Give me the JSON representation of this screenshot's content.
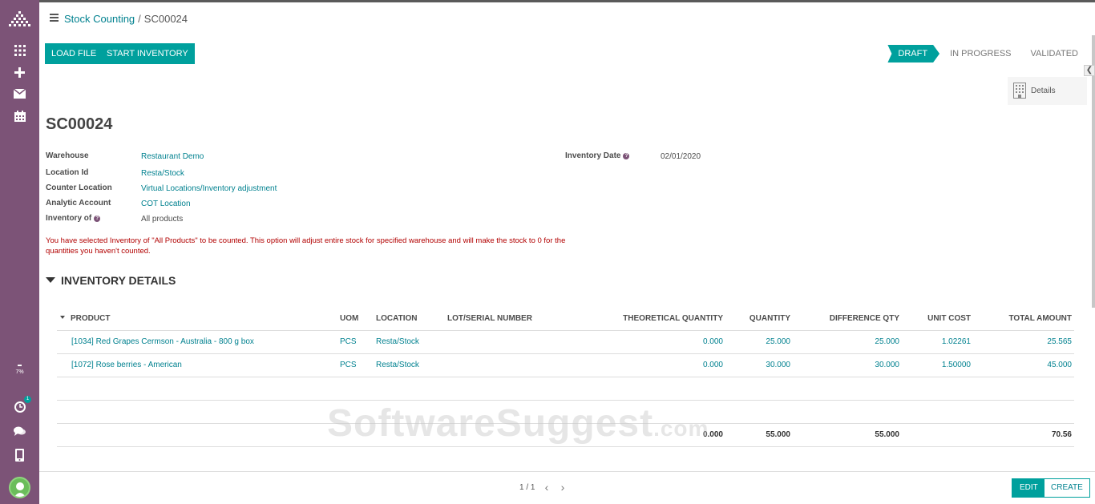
{
  "sidebar": {
    "icons": [
      "apps-icon",
      "plus-icon",
      "mail-icon",
      "calendar-icon"
    ],
    "progress_pct": "7%",
    "activity_count": "1"
  },
  "breadcrumb": {
    "parent": "Stock Counting",
    "current": "SC00024"
  },
  "buttons": {
    "load_file": "LOAD FILE",
    "start_inventory": "START INVENTORY"
  },
  "stages": [
    {
      "label": "DRAFT",
      "active": true
    },
    {
      "label": "IN PROGRESS",
      "active": false
    },
    {
      "label": "VALIDATED",
      "active": false
    }
  ],
  "details_label": "Details",
  "record": {
    "title": "SC00024",
    "fields": {
      "warehouse": {
        "label": "Warehouse",
        "value": "Restaurant Demo"
      },
      "location": {
        "label": "Location Id",
        "value": "Resta/Stock"
      },
      "counter_location": {
        "label": "Counter Location",
        "value": "Virtual Locations/Inventory adjustment"
      },
      "analytic_account": {
        "label": "Analytic Account",
        "value": "COT Location"
      },
      "inventory_of": {
        "label": "Inventory of",
        "value": "All products"
      },
      "inventory_date": {
        "label": "Inventory Date",
        "value": "02/01/2020"
      }
    },
    "warning": "You have selected Inventory of \"All Products\" to be counted. This option will adjust entire stock for specified warehouse and will make the stock to 0 for the quantities you haven't counted."
  },
  "section": {
    "title": "INVENTORY DETAILS"
  },
  "table": {
    "headers": {
      "product": "PRODUCT",
      "uom": "UOM",
      "location": "LOCATION",
      "lot": "LOT/SERIAL NUMBER",
      "theoretical": "THEORETICAL QUANTITY",
      "quantity": "QUANTITY",
      "difference": "DIFFERENCE QTY",
      "unit_cost": "UNIT COST",
      "total": "TOTAL AMOUNT"
    },
    "rows": [
      {
        "product": "[1034] Red Grapes Cermson - Australia - 800 g box",
        "uom": "PCS",
        "location": "Resta/Stock",
        "lot": "",
        "theoretical": "0.000",
        "quantity": "25.000",
        "difference": "25.000",
        "unit_cost": "1.02261",
        "total": "25.565"
      },
      {
        "product": "[1072] Rose berries - American",
        "uom": "PCS",
        "location": "Resta/Stock",
        "lot": "",
        "theoretical": "0.000",
        "quantity": "30.000",
        "difference": "30.000",
        "unit_cost": "1.50000",
        "total": "45.000"
      }
    ],
    "totals": {
      "theoretical": "0.000",
      "quantity": "55.000",
      "difference": "55.000",
      "total": "70.56"
    }
  },
  "watermark": {
    "main": "SoftwareSuggest",
    "suffix": ".com"
  },
  "footer": {
    "pager": "1 / 1",
    "edit": "EDIT",
    "create": "CREATE"
  }
}
